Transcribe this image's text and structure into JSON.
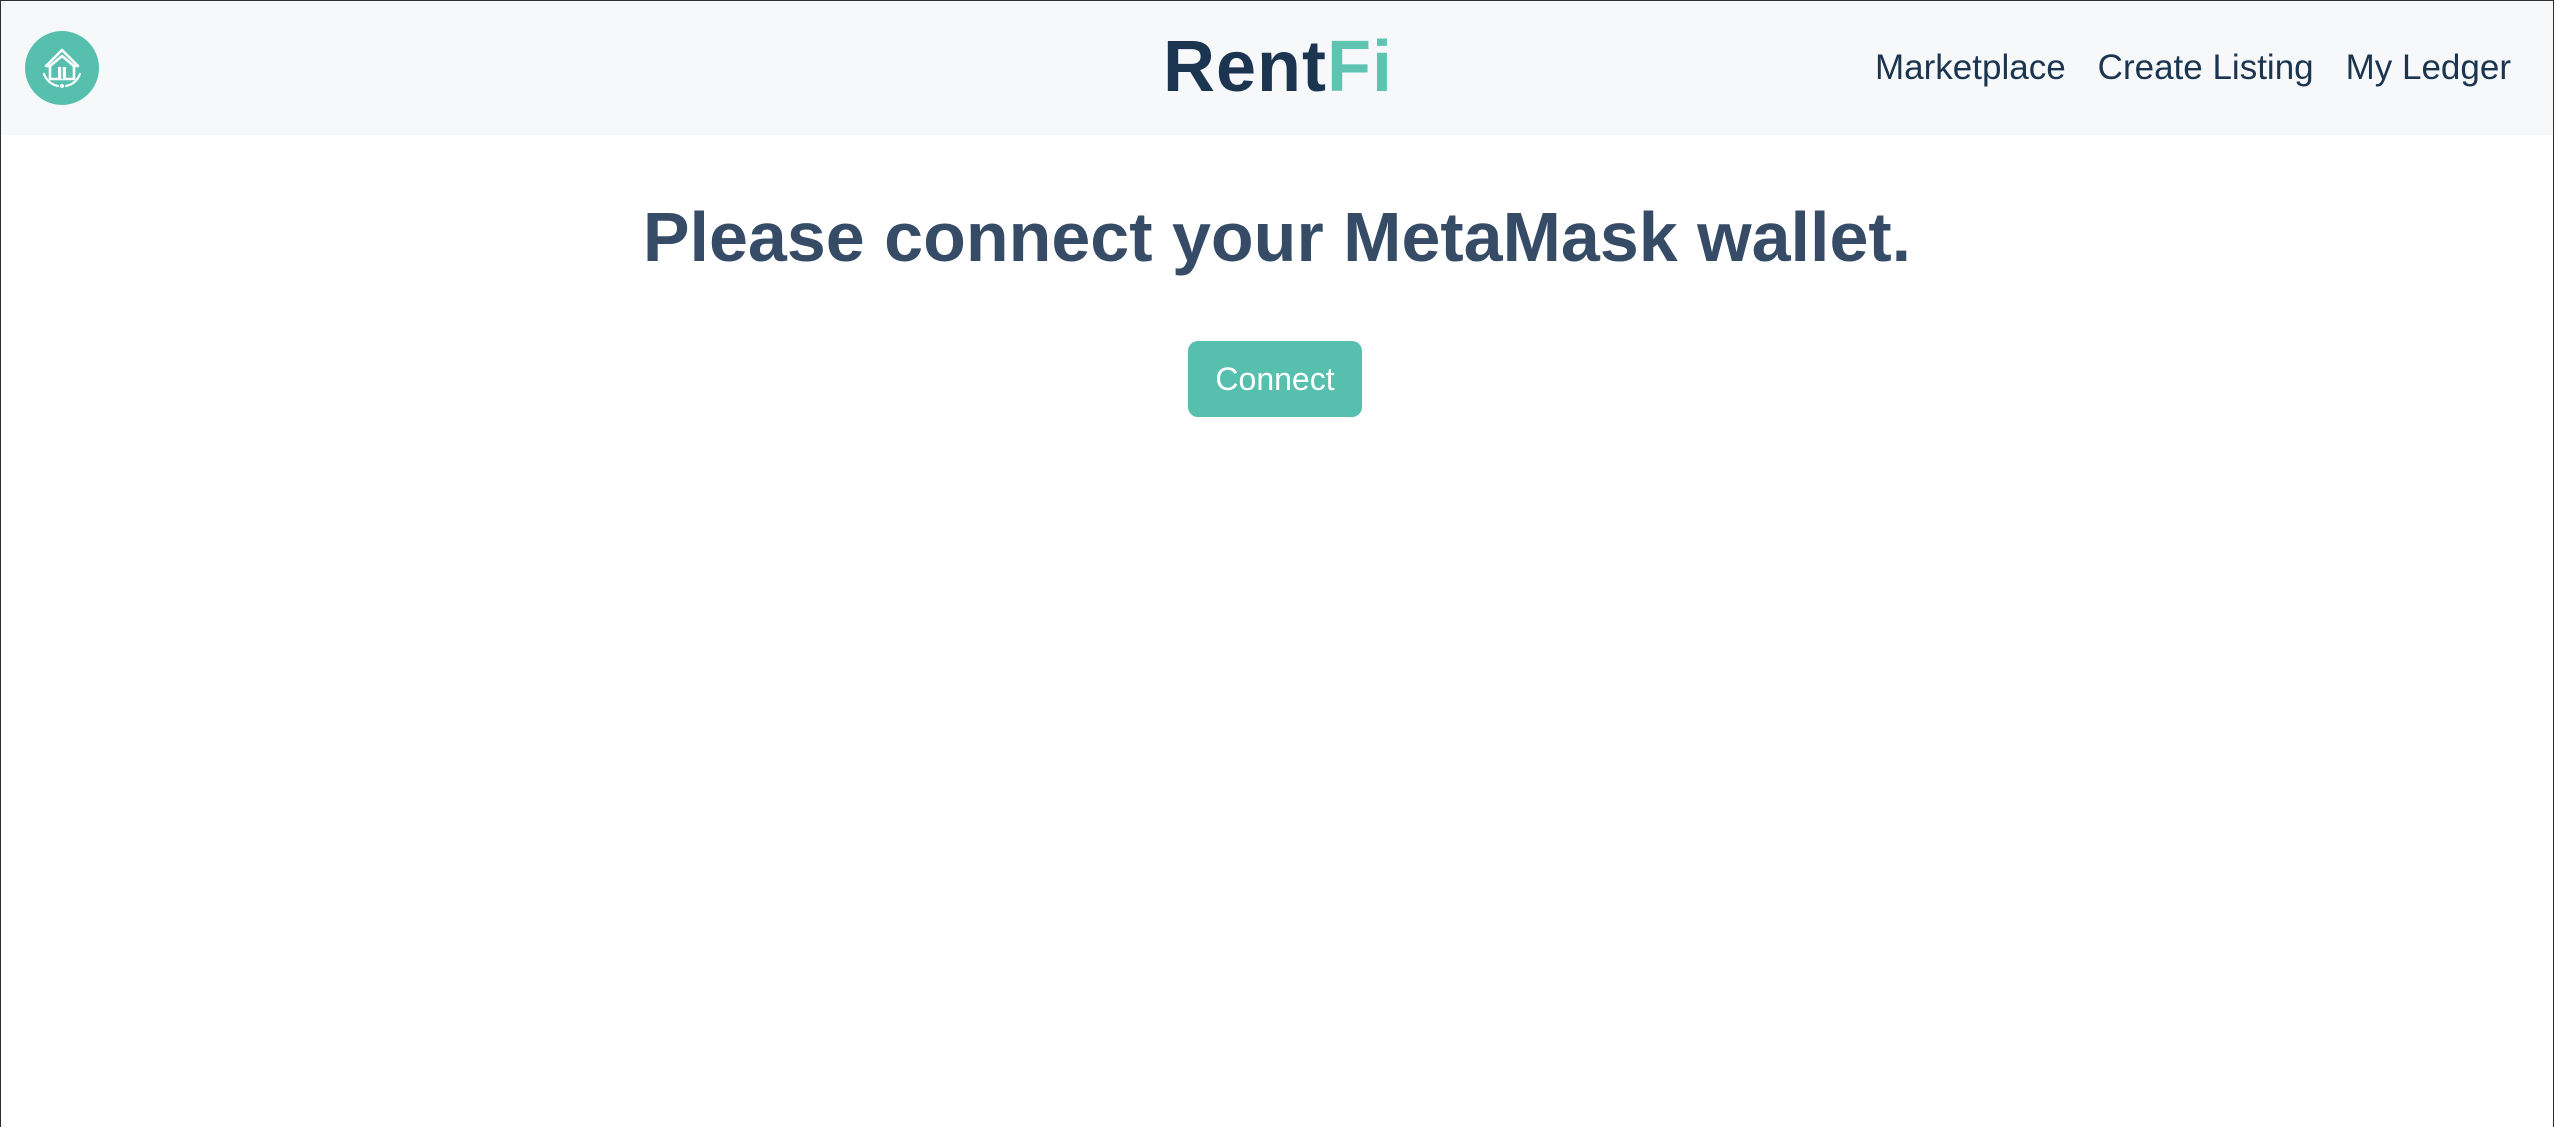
{
  "header": {
    "logo_icon": "house-rotate-icon",
    "brand_part1": "Rent",
    "brand_part2": "Fi",
    "nav": [
      {
        "label": "Marketplace"
      },
      {
        "label": "Create Listing"
      },
      {
        "label": "My Ledger"
      }
    ]
  },
  "main": {
    "heading": "Please connect your MetaMask wallet.",
    "connect_label": "Connect"
  },
  "colors": {
    "brand_dark": "#1b3550",
    "accent_teal": "#57bfae",
    "heading": "#364b66",
    "navbar_bg": "#f6f8fa"
  }
}
